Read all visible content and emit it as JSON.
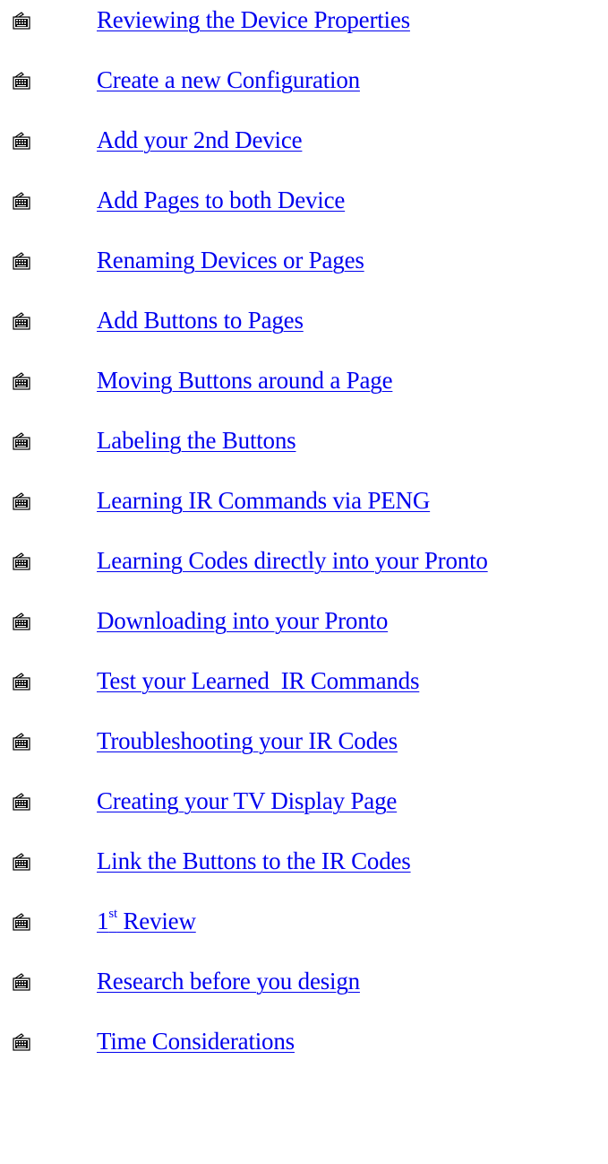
{
  "toc": {
    "bullet_icon": "keyboard-icon",
    "link_color": "#0000ee",
    "items": [
      {
        "text": "Reviewing the Device Properties"
      },
      {
        "text": "Create a new Configuration"
      },
      {
        "text": "Add your 2nd Device"
      },
      {
        "text": "Add Pages to both Device"
      },
      {
        "text": "Renaming Devices or Pages"
      },
      {
        "text": "Add Buttons to Pages"
      },
      {
        "text": "Moving Buttons around a Page"
      },
      {
        "text": "Labeling the Buttons"
      },
      {
        "text": "Learning IR Commands via PENG"
      },
      {
        "text": "Learning Codes directly into your Pronto"
      },
      {
        "text": "Downloading into your Pronto"
      },
      {
        "text": "Test your Learned  IR Commands"
      },
      {
        "text": "Troubleshooting your IR Codes"
      },
      {
        "text": "Creating your TV Display Page"
      },
      {
        "text": "Link the Buttons to the IR Codes"
      },
      {
        "num": "1",
        "sup": "st",
        "rest": " Review"
      },
      {
        "text": "Research before you design"
      },
      {
        "text": "Time Considerations"
      }
    ]
  }
}
